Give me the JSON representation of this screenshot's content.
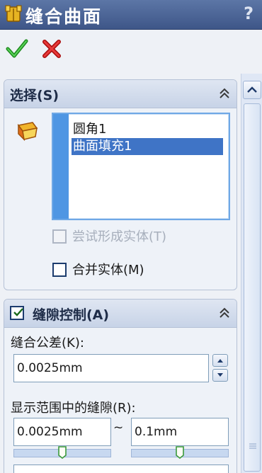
{
  "title": {
    "text": "缝合曲面",
    "help": "?"
  },
  "actions": {
    "ok_icon": "green-checkmark-icon",
    "cancel_icon": "red-x-icon"
  },
  "selection_group": {
    "title": "选择(S)",
    "items": [
      {
        "label": "圆角1",
        "selected": false
      },
      {
        "label": "曲面填充1",
        "selected": true
      }
    ],
    "try_solid": {
      "label": "尝试形成实体(T)",
      "checked": false,
      "enabled": false
    },
    "merge": {
      "label": "合并实体(M)",
      "checked": false,
      "enabled": true
    }
  },
  "gap_group": {
    "title": "缝隙控制(A)",
    "enabled": true,
    "tolerance_label": "缝合公差(K):",
    "tolerance_value": "0.0025mm",
    "range_label": "显示范围中的缝隙(R):",
    "range_min": "0.0025mm",
    "range_sep": "~",
    "range_max": "0.1mm",
    "slider_min_position": 0.5,
    "slider_max_position": 0.5
  },
  "colors": {
    "title_bar": "#4b6496",
    "selection_blue": "#3f74c6",
    "list_strip": "#4f96e3"
  }
}
